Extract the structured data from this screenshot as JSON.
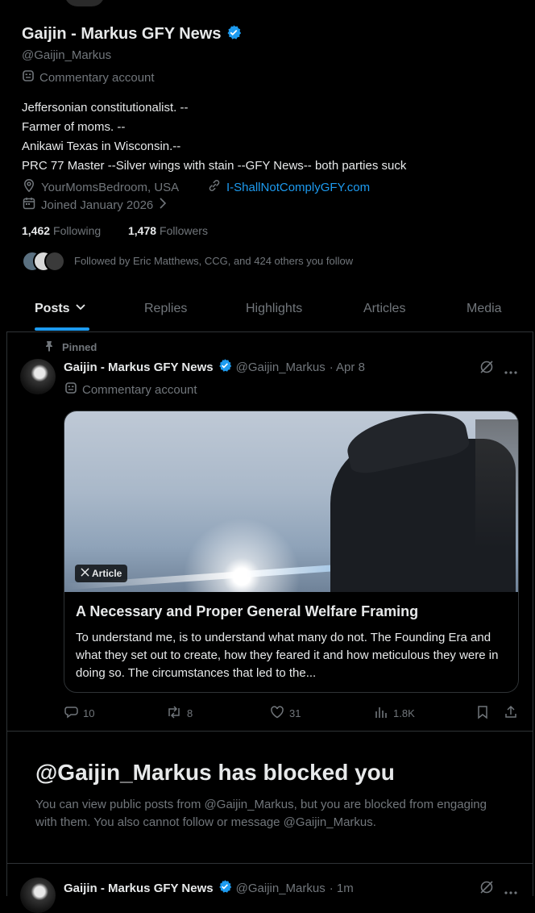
{
  "profile": {
    "name": "Gaijin - Markus GFY News",
    "handle": "@Gaijin_Markus",
    "account_label": "Commentary account",
    "bio_lines": [
      "Jeffersonian constitutionalist. --",
      "Farmer of moms. --",
      "Anikawi Texas in Wisconsin.--",
      "PRC 77 Master --Silver wings with stain --GFY News-- both parties suck"
    ],
    "location": "YourMomsBedroom, USA",
    "website": "I-ShallNotComplyGFY.com",
    "joined": "Joined January 2026",
    "following_count": "1,462",
    "following_label": "Following",
    "followers_count": "1,478",
    "followers_label": "Followers",
    "followed_by": "Followed by Eric Matthews, CCG, and 424 others you follow"
  },
  "tabs": [
    {
      "label": "Posts"
    },
    {
      "label": "Replies"
    },
    {
      "label": "Highlights"
    },
    {
      "label": "Articles"
    },
    {
      "label": "Media"
    }
  ],
  "pinned_post": {
    "pinned_label": "Pinned",
    "author_name": "Gaijin - Markus GFY News",
    "author_handle": "@Gaijin_Markus",
    "date": "· Apr 8",
    "account_label": "Commentary account",
    "article_badge": "Article",
    "article_title": "A Necessary and Proper General Welfare Framing",
    "article_excerpt": "To understand me, is to understand what many do not. The Founding Era and what they set out to create, how they feared it and how meticulous they were in doing so. The circumstances that led to the...",
    "replies": "10",
    "reposts": "8",
    "likes": "31",
    "views": "1.8K"
  },
  "blocked": {
    "title": "@Gaijin_Markus has blocked you",
    "message": "You can view public posts from @Gaijin_Markus, but you are blocked from engaging with them. You also cannot follow or message @Gaijin_Markus."
  },
  "next_post": {
    "author_name": "Gaijin - Markus GFY News",
    "author_handle": "@Gaijin_Markus",
    "date": "· 1m"
  },
  "colors": {
    "background": "#000000",
    "text": "#e7e9ea",
    "muted": "#71767b",
    "accent": "#1d9bf0",
    "border": "#2f3336"
  }
}
